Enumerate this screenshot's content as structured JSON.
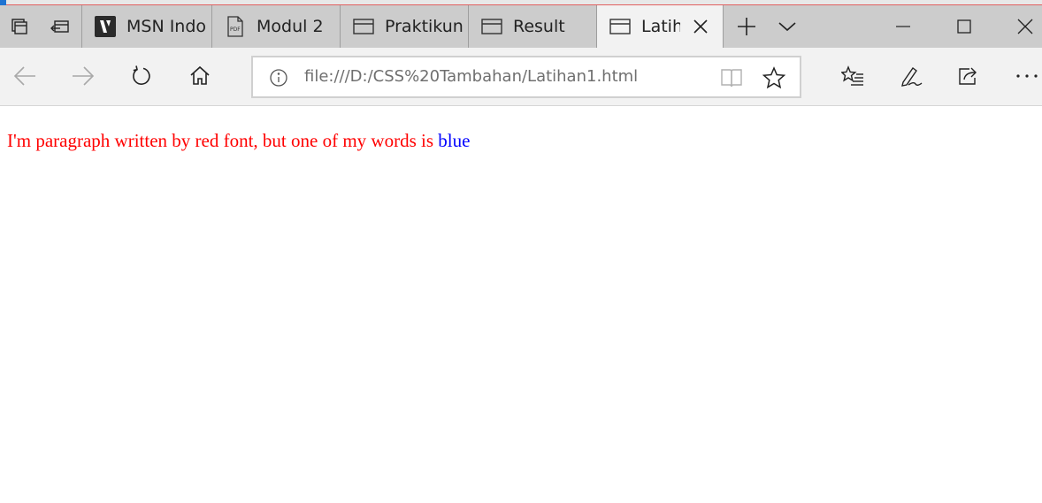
{
  "tabs": [
    {
      "label": "MSN Indo",
      "icon": "msn-icon"
    },
    {
      "label": "Modul 2",
      "icon": "pdf-icon"
    },
    {
      "label": "Praktikun",
      "icon": "window-icon"
    },
    {
      "label": "Result",
      "icon": "window-icon"
    },
    {
      "label": "Latiha",
      "icon": "window-icon",
      "active": true
    }
  ],
  "address_bar": {
    "url": "file:///D:/CSS%20Tambahan/Latihan1.html"
  },
  "page": {
    "paragraph_red": "I'm paragraph written by red font, but one of my words is ",
    "paragraph_blue": "blue"
  },
  "colors": {
    "paragraph_text": "#ff0000",
    "highlight_word": "#0000ff",
    "tab_bar": "#cccccc",
    "toolbar": "#f2f2f2"
  }
}
